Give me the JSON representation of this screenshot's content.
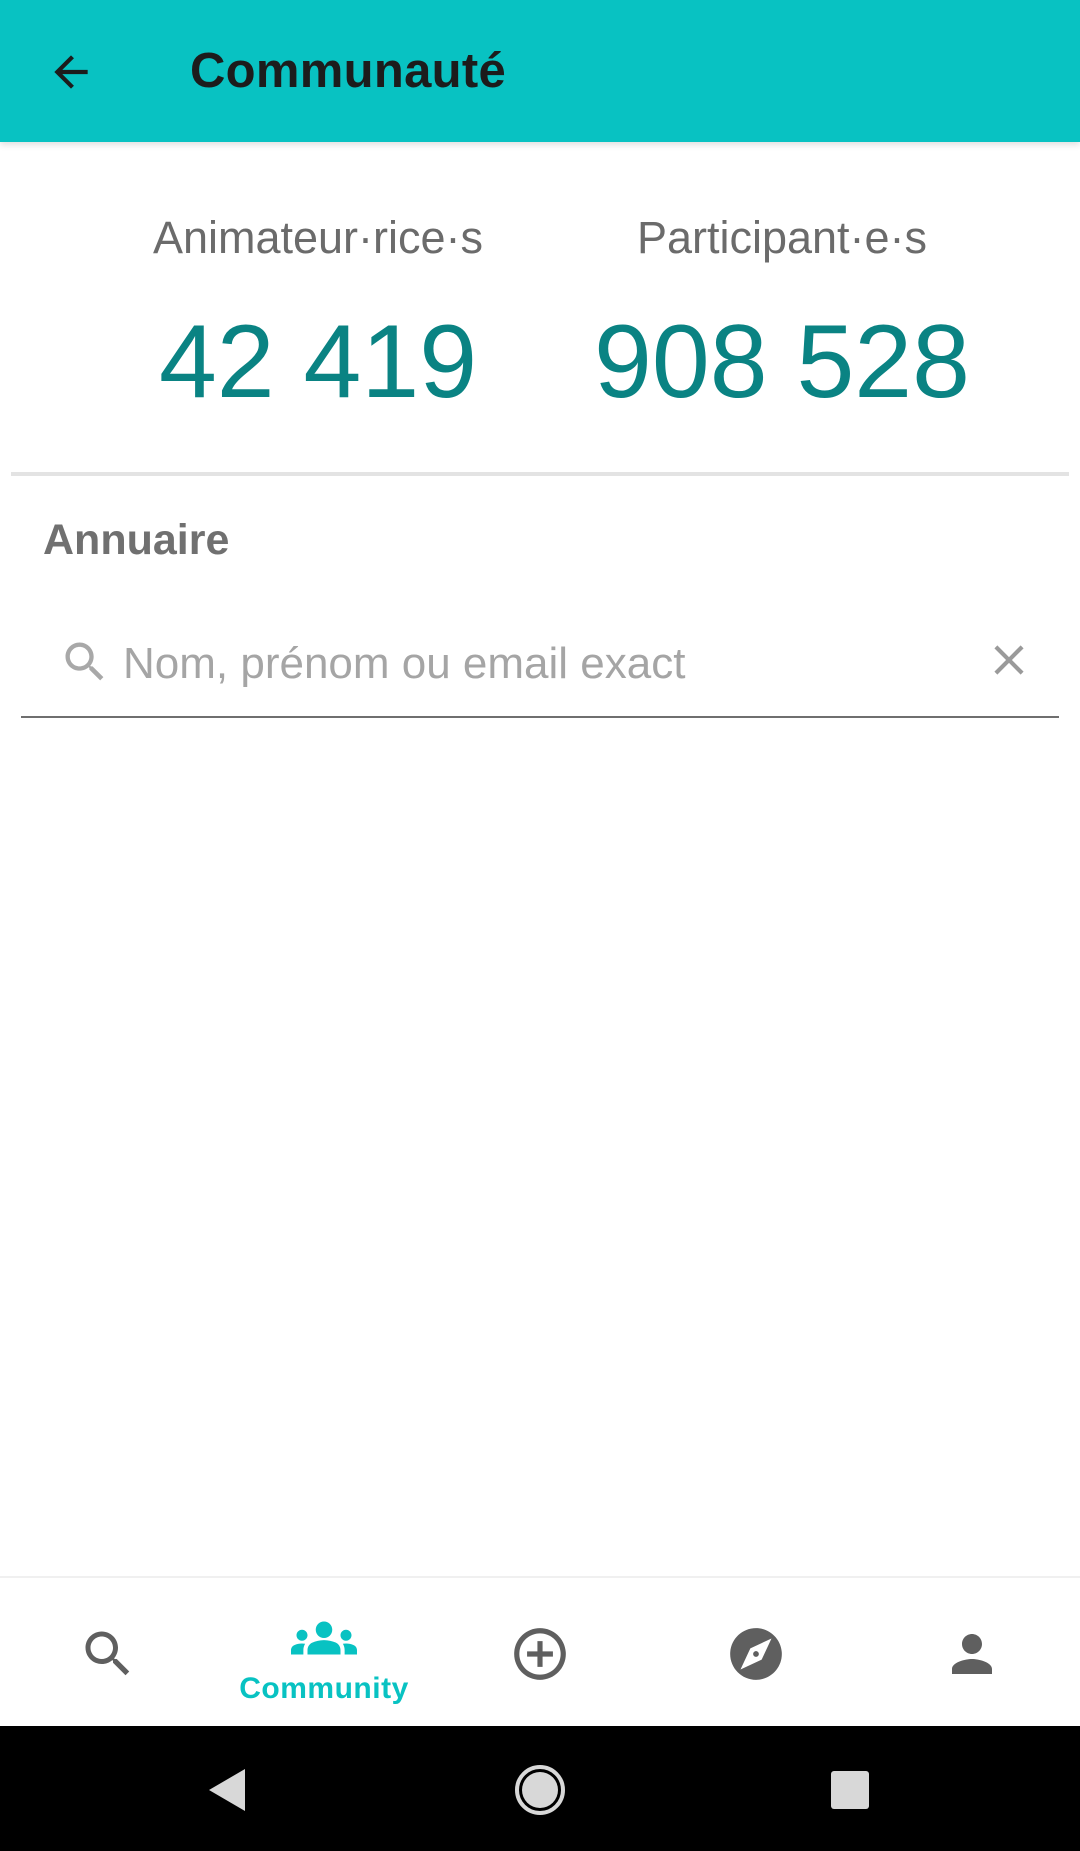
{
  "app_bar": {
    "title": "Communauté",
    "back_icon": "arrow-back-icon",
    "background_color": "#08c2c2"
  },
  "stats": {
    "animators": {
      "label": "Animateur·rice·s",
      "value": "42 419"
    },
    "participants": {
      "label": "Participant·e·s",
      "value": "908 528"
    },
    "value_color": "#0a8383"
  },
  "directory": {
    "title": "Annuaire",
    "search": {
      "value": "",
      "placeholder": "Nom, prénom ou email exact",
      "search_icon": "search-icon",
      "clear_icon": "close-icon"
    }
  },
  "bottom_nav": {
    "active_color": "#08c2c2",
    "items": [
      {
        "icon": "search-icon",
        "label": "",
        "active": false
      },
      {
        "icon": "groups-icon",
        "label": "Community",
        "active": true
      },
      {
        "icon": "add-circle-icon",
        "label": "",
        "active": false
      },
      {
        "icon": "compass-icon",
        "label": "",
        "active": false
      },
      {
        "icon": "person-icon",
        "label": "",
        "active": false
      }
    ]
  },
  "system_nav": {
    "buttons": [
      "back-triangle-icon",
      "home-circle-icon",
      "recents-square-icon"
    ]
  }
}
